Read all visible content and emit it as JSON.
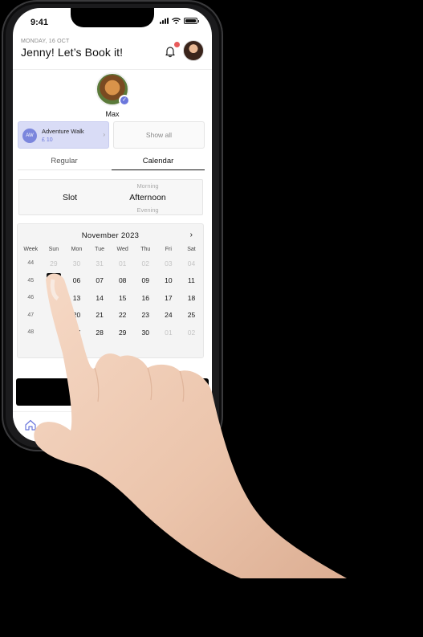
{
  "status_bar": {
    "time": "9:41"
  },
  "header": {
    "date": "MONDAY, 16 OCT",
    "greeting": "Jenny! Let’s Book it!",
    "notification_icon": "bell-icon",
    "accent": "#e85a5a"
  },
  "pet": {
    "name": "Max",
    "verified_icon": "check-icon"
  },
  "service": {
    "badge": "AW",
    "name": "Adventure  Walk",
    "price": "£ 10",
    "show_all": "Show all",
    "accent": "#6b77dc"
  },
  "tabs": [
    {
      "label": "Regular",
      "active": false
    },
    {
      "label": "Calendar",
      "active": true
    }
  ],
  "slot": {
    "label": "Slot",
    "options_above": "Morning",
    "selected": "Afternoon",
    "options_below": "Evening"
  },
  "calendar": {
    "month": "November 2023",
    "next_icon": "chevron-right-icon",
    "headers": [
      "Week",
      "Sun",
      "Mon",
      "Tue",
      "Wed",
      "Thu",
      "Fri",
      "Sat"
    ],
    "weeks": [
      {
        "week": "44",
        "days": [
          "29",
          "30",
          "31",
          "01",
          "02",
          "03",
          "04"
        ],
        "muted": [
          true,
          true,
          true,
          true,
          true,
          true,
          true
        ]
      },
      {
        "week": "45",
        "days": [
          "05",
          "06",
          "07",
          "08",
          "09",
          "10",
          "11"
        ],
        "muted": [
          false,
          false,
          false,
          false,
          false,
          false,
          false
        ]
      },
      {
        "week": "46",
        "days": [
          "",
          "13",
          "14",
          "15",
          "16",
          "17",
          "18"
        ],
        "muted": [
          false,
          false,
          false,
          false,
          false,
          false,
          false
        ]
      },
      {
        "week": "47",
        "days": [
          "",
          "20",
          "21",
          "22",
          "23",
          "24",
          "25"
        ],
        "muted": [
          false,
          false,
          false,
          false,
          false,
          false,
          false
        ]
      },
      {
        "week": "48",
        "days": [
          "",
          "27",
          "28",
          "29",
          "30",
          "01",
          "02"
        ],
        "muted": [
          false,
          false,
          false,
          false,
          false,
          true,
          true
        ]
      }
    ],
    "selected": "05"
  },
  "nav": {
    "home_icon": "home-icon"
  }
}
